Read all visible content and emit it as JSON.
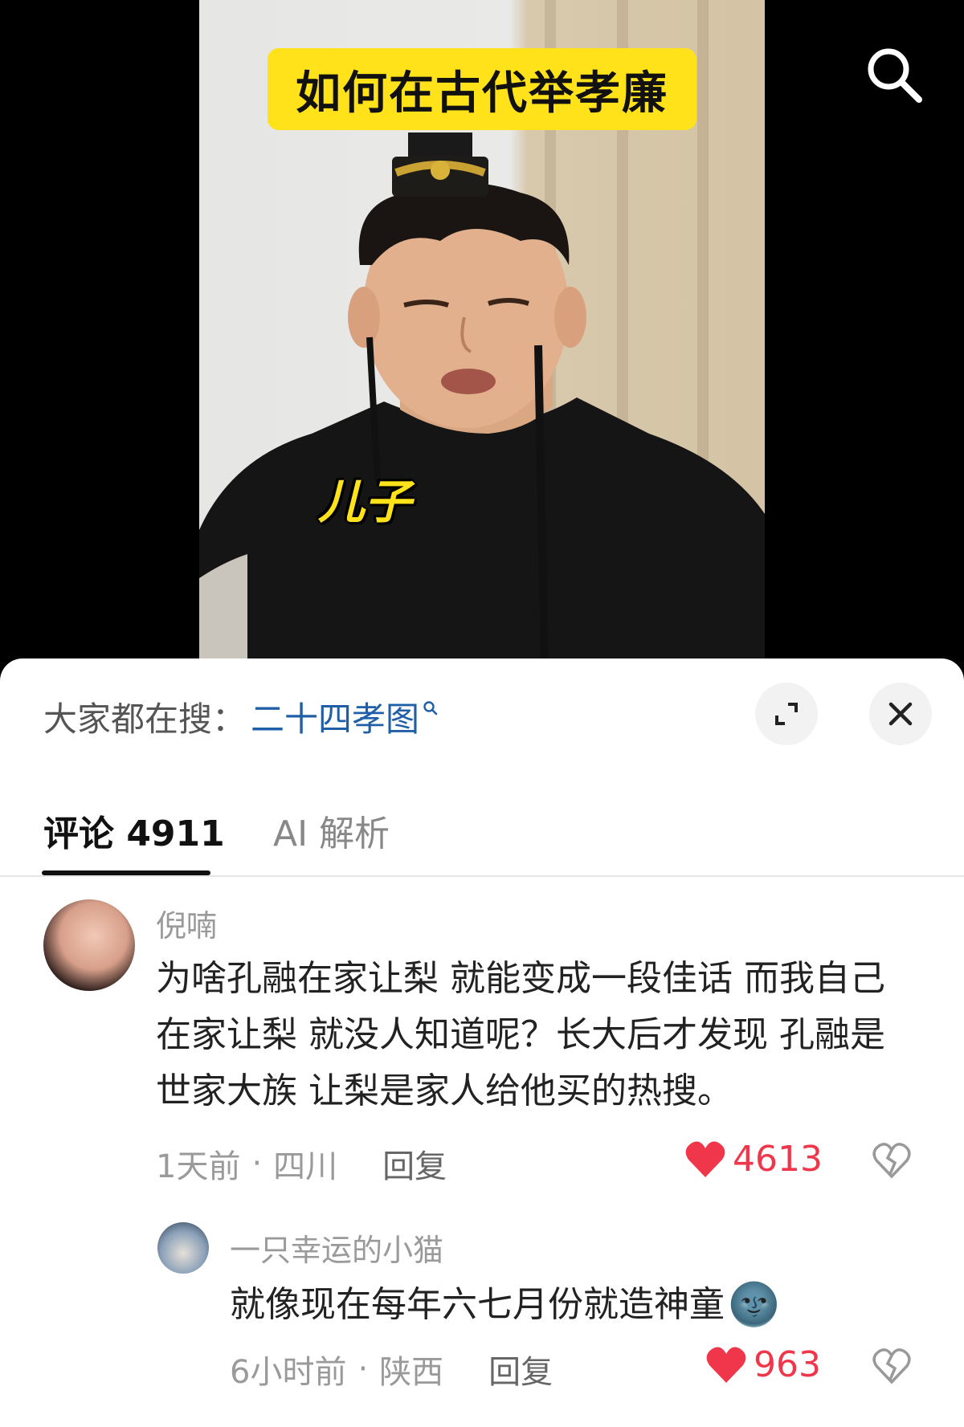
{
  "video": {
    "title": "如何在古代举孝廉",
    "caption": "儿子"
  },
  "top_bar": {
    "search_icon": "search-icon"
  },
  "sheet": {
    "hot_search_prefix": "大家都在搜：",
    "hot_search_term": "二十四孝图",
    "expand_icon": "expand-icon",
    "close_icon": "close-icon",
    "tabs": [
      {
        "label": "评论 4911",
        "active": true
      },
      {
        "label": "AI 解析",
        "active": false
      }
    ]
  },
  "comments": [
    {
      "user": "倪喃",
      "text": "为啥孔融在家让梨 就能变成一段佳话 而我自己在家让梨 就没人知道呢？长大后才发现 孔融是世家大族 让梨是家人给他买的热搜。",
      "time": "1天前",
      "location": "四川",
      "separator": "·",
      "reply_label": "回复",
      "likes": "4613"
    },
    {
      "user": "一只幸运的小猫",
      "text": "就像现在每年六七月份就造神童",
      "emoji": "🌚",
      "time": "6小时前",
      "location": "陕西",
      "separator": "·",
      "reply_label": "回复",
      "likes": "963"
    }
  ],
  "colors": {
    "banner": "#ffe21a",
    "like_red": "#f0364a",
    "link_blue": "#1f5fa8"
  }
}
